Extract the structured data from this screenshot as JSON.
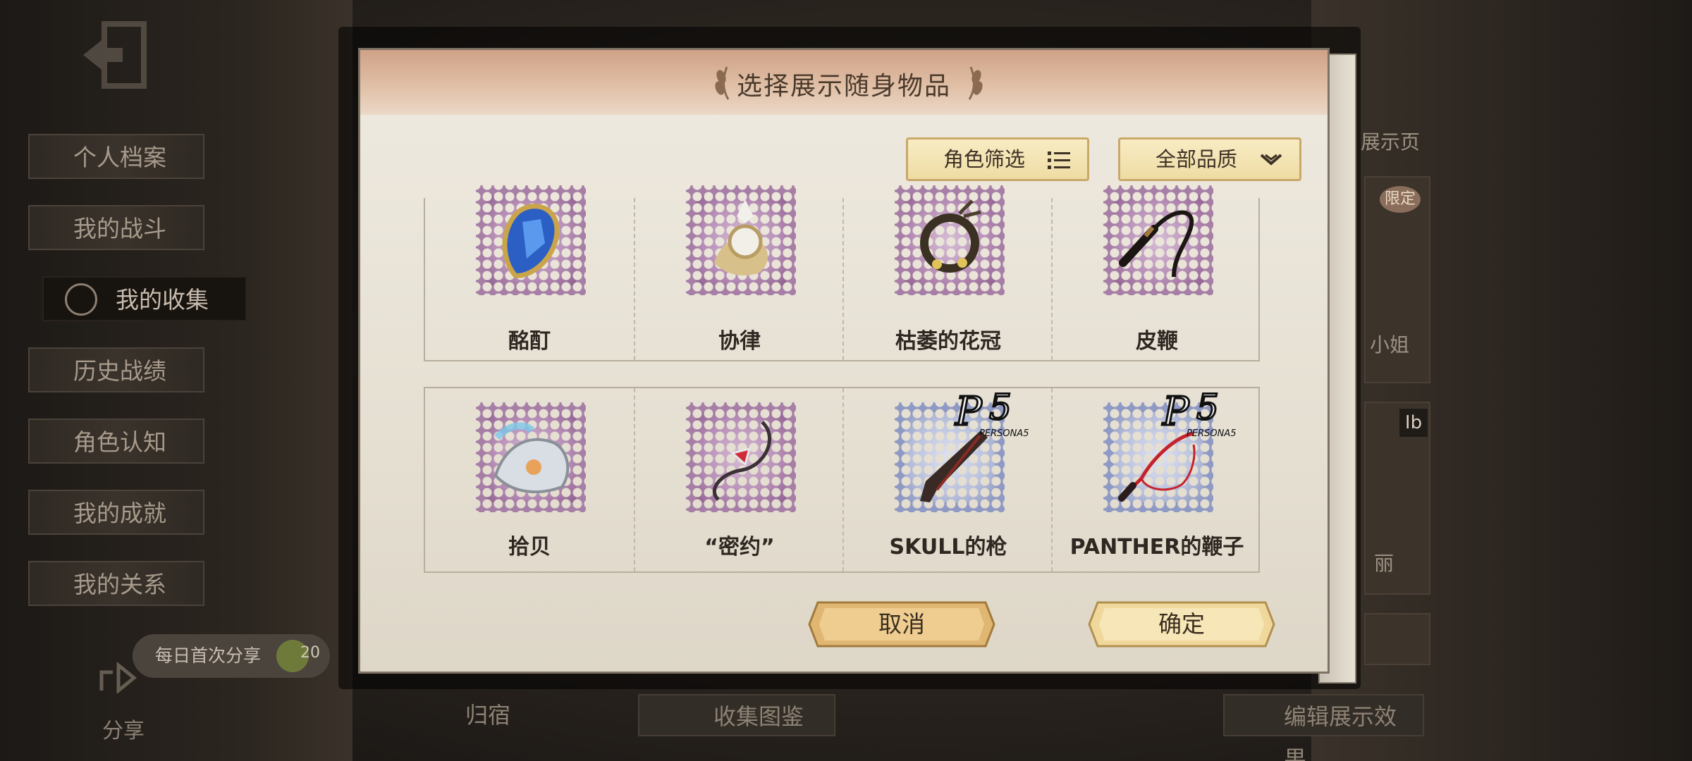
{
  "side_menu": {
    "items": [
      {
        "label": "个人档案",
        "active": false
      },
      {
        "label": "我的战斗",
        "active": false
      },
      {
        "label": "我的收集",
        "active": true
      },
      {
        "label": "历史战绩",
        "active": false
      },
      {
        "label": "角色认知",
        "active": false
      },
      {
        "label": "我的成就",
        "active": false
      },
      {
        "label": "我的关系",
        "active": false
      }
    ],
    "share_pill": {
      "label": "每日首次分享",
      "count": "20"
    },
    "share_label": "分享"
  },
  "bottom_tabs": {
    "dorm": "归宿",
    "codex": "收集图鉴",
    "edit_display": "编辑展示效果"
  },
  "right_panel": {
    "header": "展示页",
    "limited_badge": "限定",
    "card1_caption": "小姐",
    "card2_badge": "Ib",
    "card2_caption": "丽"
  },
  "modal": {
    "title": "选择展示随身物品",
    "filter_role": "角色筛选",
    "filter_quality": "全部品质",
    "items": [
      {
        "name": "酩酊",
        "frame": "purple",
        "icon": "blue-gem-heart-icon"
      },
      {
        "name": "协律",
        "frame": "purple",
        "icon": "silver-brooch-icon"
      },
      {
        "name": "枯萎的花冠",
        "frame": "purple",
        "icon": "withered-wreath-icon"
      },
      {
        "name": "皮鞭",
        "frame": "purple",
        "icon": "leather-whip-icon"
      },
      {
        "name": "拾贝",
        "frame": "purple",
        "icon": "pearl-shell-icon"
      },
      {
        "name": "“密约”",
        "frame": "purple",
        "icon": "ruby-necklace-icon"
      },
      {
        "name": "SKULL的枪",
        "frame": "p5",
        "icon": "shotgun-icon"
      },
      {
        "name": "PANTHER的鞭子",
        "frame": "p5",
        "icon": "red-whip-icon"
      }
    ],
    "p5_logo_text": "PERSONA5",
    "cancel_label": "取消",
    "confirm_label": "确定"
  },
  "colors": {
    "header_gradient_top": "#cfa287",
    "paper": "#efeae0",
    "stamp_purple": "#a67ea6",
    "stamp_p5": "#8e99c4",
    "button_gold": "#e9c98a"
  }
}
